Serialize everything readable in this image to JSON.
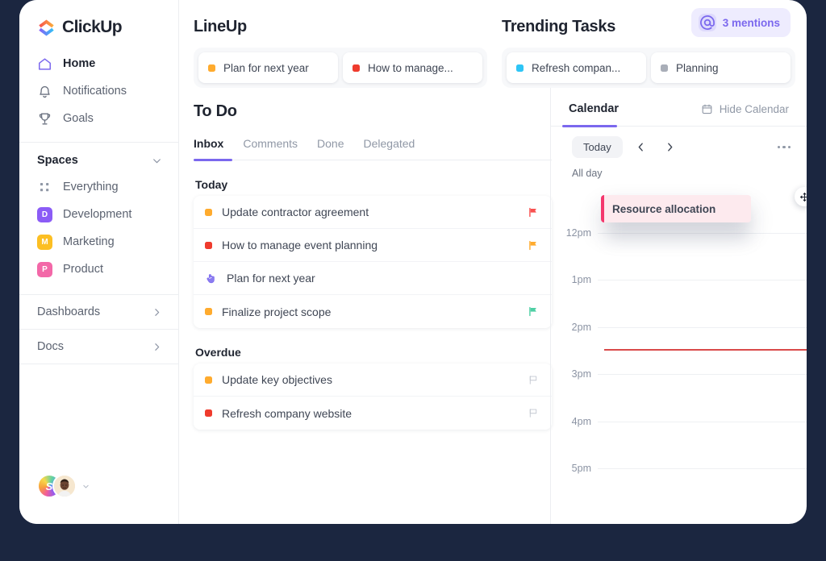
{
  "window": {
    "background": "#1b2640",
    "surface": "#ffffff"
  },
  "theme": {
    "accent": "#7b68ee",
    "text_dark": "#1f2430",
    "text_muted": "#9098a6"
  },
  "sidebar": {
    "brand": {
      "name": "ClickUp",
      "logo_icon": "clickup-logo-icon"
    },
    "nav": [
      {
        "label": "Home",
        "icon": "home-icon",
        "active": true
      },
      {
        "label": "Notifications",
        "icon": "bell-icon",
        "active": false
      },
      {
        "label": "Goals",
        "icon": "trophy-icon",
        "active": false
      }
    ],
    "spaces": {
      "title": "Spaces",
      "chevron_icon": "chevron-down-icon",
      "items": [
        {
          "label": "Everything",
          "icon": "grid-dots-icon",
          "initial": "",
          "color": ""
        },
        {
          "label": "Development",
          "icon": "space-badge",
          "initial": "D",
          "color": "#8b5cf6"
        },
        {
          "label": "Marketing",
          "icon": "space-badge",
          "initial": "M",
          "color": "#fcbf23"
        },
        {
          "label": "Product",
          "icon": "space-badge",
          "initial": "P",
          "color": "#f368a8"
        }
      ]
    },
    "links": [
      {
        "label": "Dashboards",
        "icon": "chevron-right-icon"
      },
      {
        "label": "Docs",
        "icon": "chevron-right-icon"
      }
    ],
    "footer": {
      "workspace_initial": "S",
      "workspace_avatar_name": "workspace-avatar",
      "user_avatar_name": "user-avatar",
      "caret_icon": "caret-down-icon"
    }
  },
  "lineup": {
    "title": "LineUp",
    "chips": [
      {
        "label": "Plan for next year",
        "color": "#ffab2e"
      },
      {
        "label": "How to manage...",
        "color": "#ef3b2d"
      }
    ]
  },
  "trending": {
    "title": "Trending Tasks",
    "chips": [
      {
        "label": "Refresh compan...",
        "color": "#2ec5f6"
      },
      {
        "label": "Planning",
        "color": "#a9aeb8"
      }
    ]
  },
  "mentions": {
    "label": "3 mentions",
    "icon": "at-mention-icon",
    "bg": "#eeecfe",
    "fg": "#7b68ee"
  },
  "todo": {
    "title": "To Do",
    "tabs": [
      {
        "label": "Inbox",
        "active": true
      },
      {
        "label": "Comments",
        "active": false
      },
      {
        "label": "Done",
        "active": false
      },
      {
        "label": "Delegated",
        "active": false
      }
    ],
    "groups": [
      {
        "label": "Today",
        "tasks": [
          {
            "name": "Update contractor agreement",
            "dot": "#ffab2e",
            "lead_icon": "status-dot",
            "flag": "#f8504f",
            "flag_icon": "flag-filled-icon"
          },
          {
            "name": "How to manage event planning",
            "dot": "#ef3b2d",
            "lead_icon": "status-dot",
            "flag": "#ffab2e",
            "flag_icon": "flag-filled-icon"
          },
          {
            "name": "Plan for next year",
            "dot": "",
            "lead_icon": "pointer-hand-icon",
            "flag": "",
            "flag_icon": ""
          },
          {
            "name": "Finalize project scope",
            "dot": "#ffab2e",
            "lead_icon": "status-dot",
            "flag": "#4ecfa4",
            "flag_icon": "flag-filled-icon"
          }
        ]
      },
      {
        "label": "Overdue",
        "tasks": [
          {
            "name": "Update key objectives",
            "dot": "#ffab2e",
            "lead_icon": "status-dot",
            "flag": "",
            "flag_icon": "flag-outline-icon"
          },
          {
            "name": "Refresh company website",
            "dot": "#ef3b2d",
            "lead_icon": "status-dot",
            "flag": "",
            "flag_icon": "flag-outline-icon"
          }
        ]
      }
    ]
  },
  "calendar": {
    "title": "Calendar",
    "hide_label": "Hide Calendar",
    "hide_icon": "calendar-icon",
    "today_label": "Today",
    "prev_icon": "chevron-left-icon",
    "next_icon": "chevron-right-icon",
    "more_icon": "ellipsis-icon",
    "allday_label": "All day",
    "hours": [
      "12pm",
      "1pm",
      "2pm",
      "3pm",
      "4pm",
      "5pm"
    ],
    "now_indicator_color": "#d94a4a",
    "event": {
      "name": "Resource allocation",
      "bar_color": "#f4376d",
      "bg_color": "#fdeaee",
      "handle_icon": "move-arrows-icon"
    }
  }
}
